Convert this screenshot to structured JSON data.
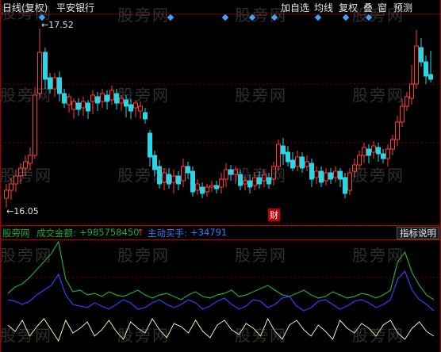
{
  "header": {
    "period": "日线",
    "adjust": "(复权)",
    "stock_name": "平安银行",
    "buttons": [
      "加自选",
      "均线",
      "复权",
      "叠",
      "窗",
      "预测"
    ]
  },
  "price_labels": {
    "high": "17.52",
    "low": "16.05"
  },
  "event_marker": "财",
  "indicator_bar": {
    "source": "股旁网",
    "turnover_label": "成交金额:",
    "turnover_value": "+985758450",
    "arrow": "↑",
    "active_buy_label": "主动买手:",
    "active_buy_value": "+34791",
    "explain_button": "指标说明"
  },
  "watermark_text": "股旁网",
  "colors": {
    "up": "#ff3b3b",
    "down": "#29d6e6",
    "green_line": "#1faa3a",
    "blue_line": "#3a3aff",
    "yellow_line": "#f0f0a0",
    "diamond": "#3aa6ff"
  }
}
